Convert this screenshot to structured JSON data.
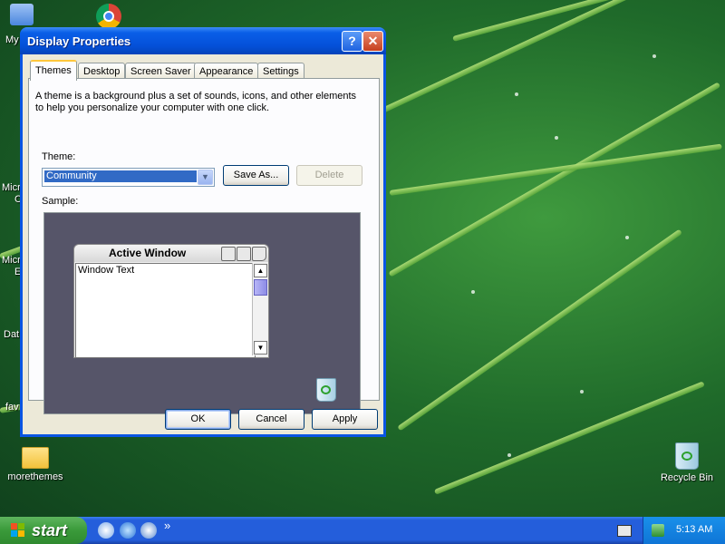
{
  "desktop": {
    "icons": [
      {
        "label": "morethemes"
      },
      {
        "label": "Recycle Bin"
      }
    ],
    "clipped_labels": [
      "My",
      "Micr",
      "C",
      "Micr",
      "E",
      "Dat",
      "fav"
    ]
  },
  "window": {
    "title": "Display Properties",
    "help_glyph": "?",
    "close_glyph": "✕",
    "tabs": [
      "Themes",
      "Desktop",
      "Screen Saver",
      "Appearance",
      "Settings"
    ],
    "active_tab": "Themes",
    "description": "A theme is a background plus a set of sounds, icons, and other elements to help you personalize your computer with one click.",
    "theme_label": "Theme:",
    "theme_value": "Community",
    "save_as_label": "Save As...",
    "delete_label": "Delete",
    "sample_label": "Sample:",
    "sample_window_title": "Active Window",
    "sample_window_text": "Window Text",
    "ok_label": "OK",
    "cancel_label": "Cancel",
    "apply_label": "Apply"
  },
  "taskbar": {
    "start_label": "start",
    "overflow_glyph": "»",
    "clock": "5:13 AM"
  },
  "colors": {
    "xp_blue": "#0a55e3",
    "start_green": "#3a9a3a",
    "sample_bg": "#565569"
  }
}
